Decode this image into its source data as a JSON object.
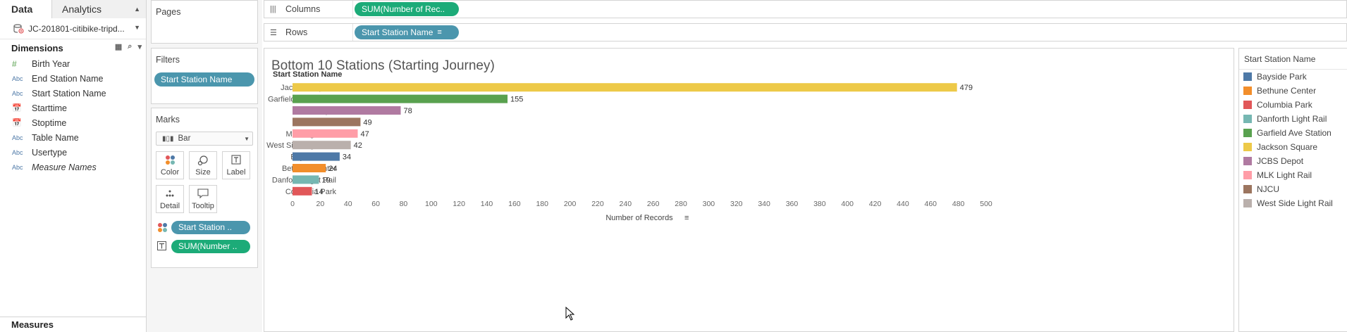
{
  "left": {
    "tabs": {
      "data": "Data",
      "analytics": "Analytics"
    },
    "datasource": "JC-201801-citibike-tripd...",
    "dimensions_label": "Dimensions",
    "fields": [
      {
        "type": "#",
        "label": "Birth Year"
      },
      {
        "type": "Abc",
        "label": "End Station Name"
      },
      {
        "type": "Abc",
        "label": "Start Station Name"
      },
      {
        "type": "date",
        "label": "Starttime"
      },
      {
        "type": "date",
        "label": "Stoptime"
      },
      {
        "type": "Abc",
        "label": "Table Name"
      },
      {
        "type": "Abc",
        "label": "Usertype"
      },
      {
        "type": "Abc",
        "label": "Measure Names"
      }
    ],
    "measures_label": "Measures"
  },
  "cards": {
    "pages": "Pages",
    "filters": "Filters",
    "filter_pill": "Start Station Name",
    "marks": "Marks",
    "mark_type": "Bar",
    "buttons": {
      "color": "Color",
      "size": "Size",
      "label": "Label",
      "detail": "Detail",
      "tooltip": "Tooltip"
    },
    "pill_color": "Start Station ..",
    "pill_label": "SUM(Number ..",
    "colors": {
      "dimension": "#4b96ad",
      "measure": "#1cab78"
    }
  },
  "shelves": {
    "columns_label": "Columns",
    "columns_pill": "SUM(Number of Rec..",
    "rows_label": "Rows",
    "rows_pill": "Start Station Name"
  },
  "legend": {
    "title": "Start Station Name",
    "items": [
      {
        "label": "Bayside Park",
        "color": "#4e79a7"
      },
      {
        "label": "Bethune Center",
        "color": "#f28e2b"
      },
      {
        "label": "Columbia Park",
        "color": "#e15759"
      },
      {
        "label": "Danforth Light Rail",
        "color": "#76b7b2"
      },
      {
        "label": "Garfield Ave Station",
        "color": "#59a14f"
      },
      {
        "label": "Jackson Square",
        "color": "#edc948"
      },
      {
        "label": "JCBS Depot",
        "color": "#b07aa1"
      },
      {
        "label": "MLK Light Rail",
        "color": "#ff9da7"
      },
      {
        "label": "NJCU",
        "color": "#9c755f"
      },
      {
        "label": "West Side Light Rail",
        "color": "#bab0ac"
      }
    ]
  },
  "chart_data": {
    "type": "bar",
    "orientation": "horizontal",
    "title": "Bottom 10 Stations (Starting Journey)",
    "row_header": "Start Station Name",
    "xlabel": "Number of Records",
    "xlim": [
      0,
      500
    ],
    "xticks": [
      0,
      20,
      40,
      60,
      80,
      100,
      120,
      140,
      160,
      180,
      200,
      220,
      240,
      260,
      280,
      300,
      320,
      340,
      360,
      380,
      400,
      420,
      440,
      460,
      480,
      500
    ],
    "categories": [
      "Jackson Square",
      "Garfield Ave Station",
      "JCBS Depot",
      "NJCU",
      "MLK Light Rail",
      "West Side Light Rail",
      "Bayside Park",
      "Bethune Center",
      "Danforth Light Rail",
      "Columbia Park"
    ],
    "values": [
      479,
      155,
      78,
      49,
      47,
      42,
      34,
      24,
      19,
      14
    ],
    "colors": [
      "#edc948",
      "#59a14f",
      "#b07aa1",
      "#9c755f",
      "#ff9da7",
      "#bab0ac",
      "#4e79a7",
      "#f28e2b",
      "#76b7b2",
      "#e15759"
    ],
    "grid": false
  }
}
